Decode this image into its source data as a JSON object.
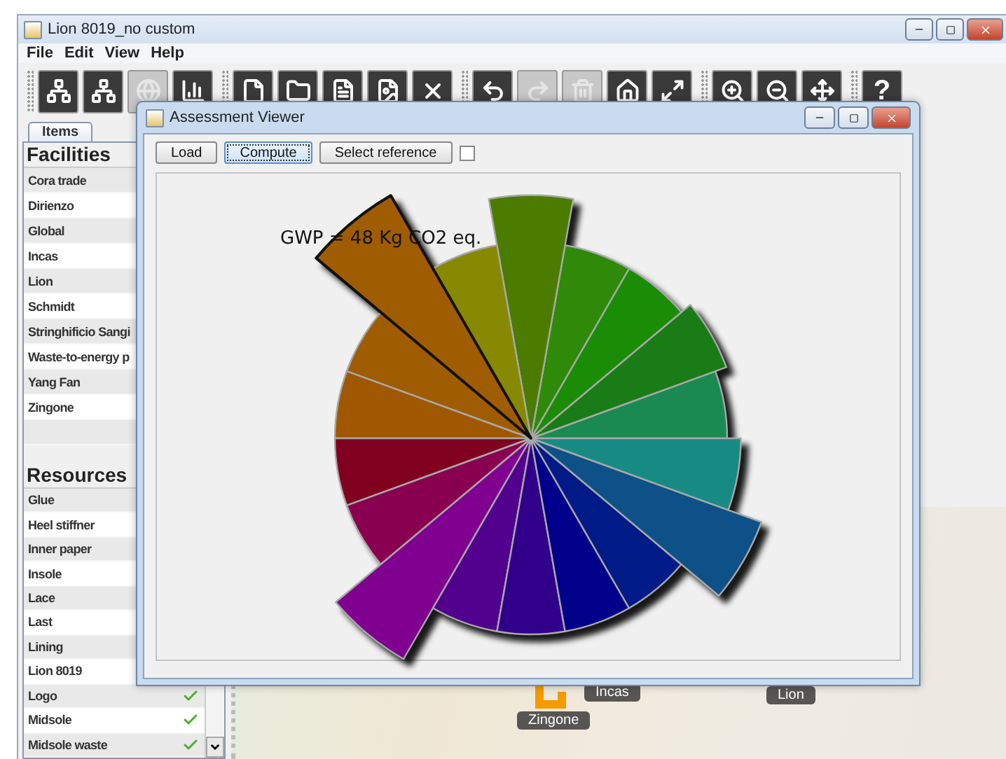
{
  "window": {
    "title": "Lion 8019_no custom"
  },
  "menu": [
    "File",
    "Edit",
    "View",
    "Help"
  ],
  "toolbar": {
    "groups": [
      [
        {
          "disabled": false
        },
        {
          "disabled": false
        },
        {
          "disabled": true
        },
        {
          "disabled": false
        }
      ],
      [
        {
          "disabled": false
        },
        {
          "disabled": false
        },
        {
          "disabled": false
        },
        {
          "disabled": false
        },
        {
          "disabled": false
        }
      ],
      [
        {
          "disabled": false
        },
        {
          "disabled": true
        },
        {
          "disabled": true
        },
        {
          "disabled": false
        },
        {
          "disabled": false
        }
      ],
      [
        {
          "disabled": false
        },
        {
          "disabled": false
        },
        {
          "disabled": false
        }
      ],
      [
        {
          "disabled": false,
          "label": "?"
        }
      ]
    ]
  },
  "items_panel": {
    "tab": {
      "label": "Items",
      "selected": true
    },
    "facilities": {
      "heading": "Facilities",
      "items": [
        "Cora trade",
        "Dirienzo",
        "Global",
        "Incas",
        "Lion",
        "Schmidt",
        "Stringhificio Sangi",
        "Waste-to-energy p",
        "Yang Fan",
        "Zingone"
      ]
    },
    "resources": {
      "heading": "Resources",
      "items": [
        {
          "name": "Glue"
        },
        {
          "name": "Heel stiffner"
        },
        {
          "name": "Inner paper"
        },
        {
          "name": "Insole"
        },
        {
          "name": "Lace"
        },
        {
          "name": "Last"
        },
        {
          "name": "Lining"
        },
        {
          "name": "Lion 8019"
        },
        {
          "name": "Logo",
          "checked": true
        },
        {
          "name": "Midsole",
          "checked": true
        },
        {
          "name": "Midsole waste",
          "checked": true
        }
      ]
    }
  },
  "map": {
    "markers": [
      {
        "label": "Incas"
      },
      {
        "label": "Zingone"
      },
      {
        "label": "Lion"
      }
    ]
  },
  "dialog": {
    "title": "Assessment Viewer",
    "buttons": [
      {
        "label": "Load",
        "focused": false
      },
      {
        "label": "Compute",
        "focused": true
      },
      {
        "label": "Select reference",
        "focused": false
      }
    ],
    "reference_checkbox": {
      "checked": false
    },
    "chart": {
      "caption": "GWP = 48 Kg CO2  eq."
    }
  }
}
